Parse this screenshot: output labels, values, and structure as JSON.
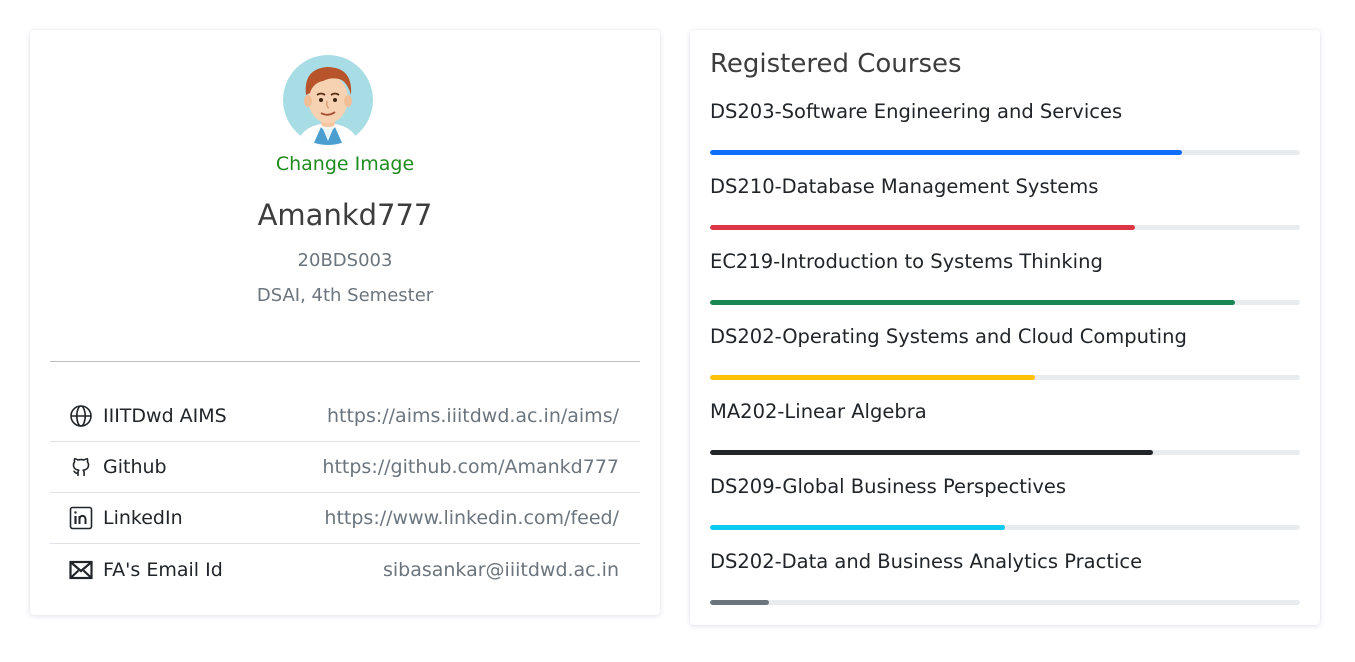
{
  "profile": {
    "change_image": "Change Image",
    "name": "Amankd777",
    "roll_no": "20BDS003",
    "program": "DSAI, 4th Semester",
    "links": [
      {
        "label": "IIITDwd AIMS",
        "url": "https://aims.iiitdwd.ac.in/aims/",
        "icon": "globe-icon"
      },
      {
        "label": "Github",
        "url": "https://github.com/Amankd777",
        "icon": "github-icon"
      },
      {
        "label": "LinkedIn",
        "url": "https://www.linkedin.com/feed/",
        "icon": "linkedin-icon"
      },
      {
        "label": "FA's Email Id",
        "url": "sibasankar@iiitdwd.ac.in",
        "icon": "envelope-icon"
      }
    ]
  },
  "courses": {
    "title": "Registered Courses",
    "items": [
      {
        "name": "DS203-Software Engineering and Services",
        "progress": 0.8,
        "color": "#0d6efd"
      },
      {
        "name": "DS210-Database Management Systems",
        "progress": 0.72,
        "color": "#dc3545"
      },
      {
        "name": "EC219-Introduction to Systems Thinking",
        "progress": 0.89,
        "color": "#198754"
      },
      {
        "name": "DS202-Operating Systems and Cloud Computing",
        "progress": 0.55,
        "color": "#ffc107"
      },
      {
        "name": "MA202-Linear Algebra",
        "progress": 0.75,
        "color": "#212529"
      },
      {
        "name": "DS209-Global Business Perspectives",
        "progress": 0.5,
        "color": "#0dcaf0"
      },
      {
        "name": "DS202-Data and Business Analytics Practice",
        "progress": 0.1,
        "color": "#6c757d"
      }
    ]
  }
}
